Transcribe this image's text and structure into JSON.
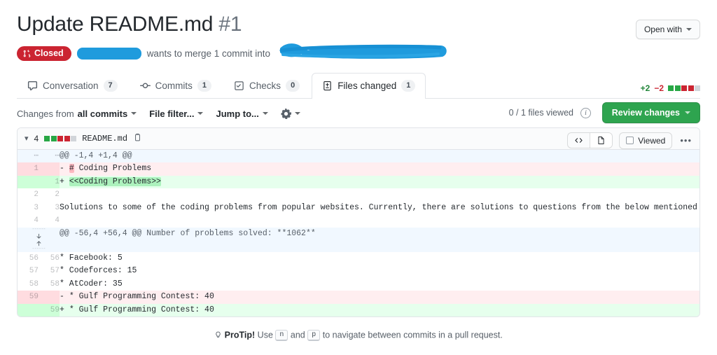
{
  "header": {
    "title": "Update README.md",
    "number": "#1",
    "open_with_label": "Open with",
    "state": "Closed",
    "state_color": "#cb2431",
    "merge_sentence": "wants to merge 1 commit into",
    "redacted_author": "",
    "redacted_branch": ""
  },
  "tabs": [
    {
      "label": "Conversation",
      "count": "7",
      "icon": "comment-icon",
      "active": false
    },
    {
      "label": "Commits",
      "count": "1",
      "icon": "commit-icon",
      "active": false
    },
    {
      "label": "Checks",
      "count": "0",
      "icon": "checklist-icon",
      "active": false
    },
    {
      "label": "Files changed",
      "count": "1",
      "icon": "file-diff-icon",
      "active": true
    }
  ],
  "diffstat": {
    "additions": "+2",
    "deletions": "−2",
    "blocks": [
      "g",
      "g",
      "r",
      "r",
      "n"
    ],
    "add_color": "#22863a",
    "del_color": "#cb2431"
  },
  "toolbar": {
    "changes_from_prefix": "Changes from",
    "changes_from_value": "all commits",
    "file_filter": "File filter...",
    "jump_to": "Jump to...",
    "gear_icon": "gear-icon",
    "files_viewed": "0 / 1 files viewed",
    "info_icon": "info-icon",
    "review_changes": "Review changes",
    "review_color": "#2ea44f"
  },
  "file": {
    "changes_count": "4",
    "blocks": [
      "g",
      "g",
      "r",
      "r",
      "n"
    ],
    "name": "README.md",
    "copy_icon": "copy-icon",
    "collapse_icon": "chevron-down-icon",
    "code_view_icon": "code-icon",
    "blob_view_icon": "file-icon",
    "viewed_label": "Viewed",
    "kebab_icon": "kebab-menu-icon"
  },
  "hunks": [
    {
      "header": "@@ -1,4 +1,4 @@",
      "expander": false,
      "lines": [
        {
          "type": "del",
          "old": "1",
          "new": "",
          "marker": "-",
          "pre": "",
          "hl": "#",
          "post": " Coding Problems"
        },
        {
          "type": "add",
          "old": "",
          "new": "1",
          "marker": "+",
          "pre": "",
          "hl": "<<Coding Problems>>",
          "post": ""
        },
        {
          "type": "ctx",
          "old": "2",
          "new": "2",
          "marker": " ",
          "text": ""
        },
        {
          "type": "ctx",
          "old": "3",
          "new": "3",
          "marker": " ",
          "text": "Solutions to some of the coding problems from popular websites. Currently, there are solutions to questions from the below mentioned websites:"
        },
        {
          "type": "ctx",
          "old": "4",
          "new": "4",
          "marker": " ",
          "text": ""
        }
      ]
    },
    {
      "header": "@@ -56,4 +56,4 @@ Number of problems solved: **1062**",
      "expander": true,
      "lines": [
        {
          "type": "ctx",
          "old": "56",
          "new": "56",
          "marker": " ",
          "text": "* Facebook: 5"
        },
        {
          "type": "ctx",
          "old": "57",
          "new": "57",
          "marker": " ",
          "text": "* Codeforces: 15"
        },
        {
          "type": "ctx",
          "old": "58",
          "new": "58",
          "marker": " ",
          "text": "* AtCoder: 35"
        },
        {
          "type": "del",
          "old": "59",
          "new": "",
          "marker": "-",
          "pre": "* Gulf Programming Contest: 40",
          "hl": "",
          "post": ""
        },
        {
          "type": "add",
          "old": "",
          "new": "59",
          "marker": "+",
          "pre": "* Gulf Programming Contest: 40",
          "hl": "",
          "post": ""
        }
      ]
    }
  ],
  "footer": {
    "icon": "lightbulb-icon",
    "label": "ProTip!",
    "text_before": "Use",
    "key1": "n",
    "and": "and",
    "key2": "p",
    "text_after": "to navigate between commits in a pull request."
  }
}
